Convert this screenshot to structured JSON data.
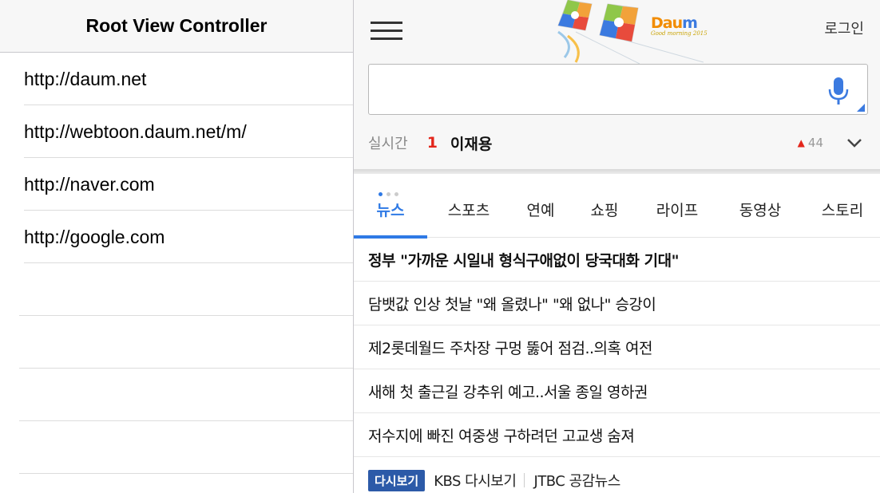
{
  "master": {
    "title": "Root View Controller",
    "urls": [
      "http://daum.net",
      "http://webtoon.daum.net/m/",
      "http://naver.com",
      "http://google.com"
    ]
  },
  "web": {
    "header": {
      "login_label": "로그인",
      "logo": {
        "text": "Daum",
        "subtitle": "Good morning 2015"
      },
      "search": {
        "value": "",
        "placeholder": ""
      }
    },
    "realtime": {
      "label": "실시간",
      "rank": "1",
      "keyword": "이재용",
      "change": "44",
      "change_direction": "up"
    },
    "tabs": [
      {
        "label": "뉴스",
        "active": true
      },
      {
        "label": "스포츠"
      },
      {
        "label": "연예"
      },
      {
        "label": "쇼핑"
      },
      {
        "label": "라이프"
      },
      {
        "label": "동영상"
      },
      {
        "label": "스토리"
      }
    ],
    "news": [
      "정부 \"가까운 시일내 형식구애없이 당국대화 기대\"",
      "담뱃값 인상 첫날 \"왜 올렸나\" \"왜 없나\" 승강이",
      "제2롯데월드 주차장 구멍 뚫어 점검..의혹 여전",
      "새해 첫 출근길 강추위 예고..서울 종일 영하권",
      "저수지에 빠진 여중생 구하려던 고교생 숨져"
    ],
    "replay": {
      "badge": "다시보기",
      "links": [
        "KBS 다시보기",
        "JTBC 공감뉴스"
      ]
    },
    "colors": {
      "accent": "#2f7ae5",
      "rank_red": "#e3261b",
      "badge_blue": "#2c5aa8"
    }
  }
}
